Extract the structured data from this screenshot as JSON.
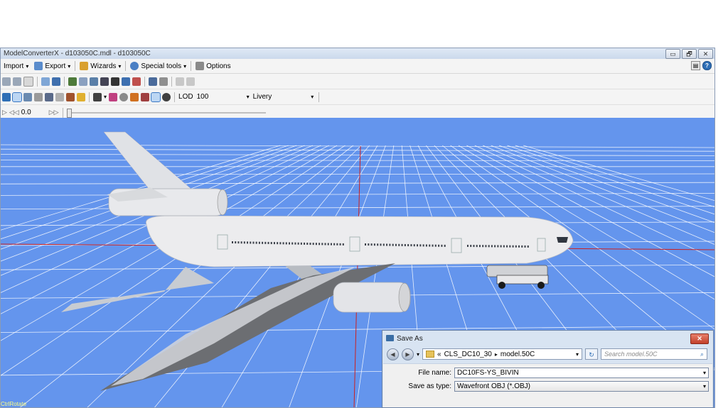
{
  "window": {
    "title": "ModelConverterX - d103050C.mdl - d103050C",
    "buttons": {
      "minimize": "▭",
      "restore": "🗗",
      "close": "✕"
    }
  },
  "menubar": {
    "import": "Import",
    "export": "Export",
    "wizards": "Wizards",
    "special_tools": "Special tools",
    "options": "Options",
    "help": "?"
  },
  "toolbar3": {
    "lod_label": "LOD",
    "lod_value": "100",
    "livery_label": "Livery",
    "livery_value": ""
  },
  "toolbar4": {
    "time_value": "0.0",
    "slider_level": 0
  },
  "viewport": {
    "status": "CtrlRotate",
    "background_color": "#6495ed",
    "grid_color": "#ffffff",
    "axis_x_color": "#cc2020",
    "axis_z_color": "#cc2020"
  },
  "dialog": {
    "title": "Save As",
    "breadcrumb": [
      "«",
      "CLS_DC10_30",
      "model.50C"
    ],
    "search_placeholder": "Search model.50C",
    "file_name_label": "File name:",
    "file_name_value": "DC10FS-YS_BIVIN",
    "save_type_label": "Save as type:",
    "save_type_value": "Wavefront OBJ (*.OBJ)"
  }
}
